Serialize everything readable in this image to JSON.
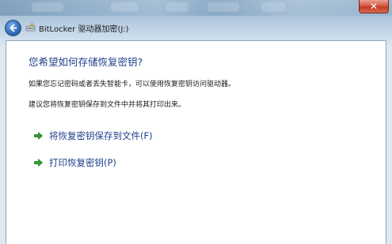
{
  "window": {
    "nav_title": "BitLocker 驱动器加密(J:)",
    "close_label": "✕"
  },
  "main": {
    "heading": "您希望如何存储恢复密钥?",
    "description_1": "如果您忘记密码或者丢失智能卡，可以使用恢复密钥访问驱动器。",
    "description_2": "建议您将恢复密钥保存到文件中并将其打印出来。",
    "commands": [
      {
        "label": "将恢复密钥保存到文件(F)",
        "icon": "green-arrow-icon"
      },
      {
        "label": "打印恢复密钥(P)",
        "icon": "green-arrow-icon"
      }
    ]
  },
  "colors": {
    "accent_text": "#1e3f8a",
    "arrow_green": "#2e9e2e",
    "close_red": "#c43a22"
  }
}
